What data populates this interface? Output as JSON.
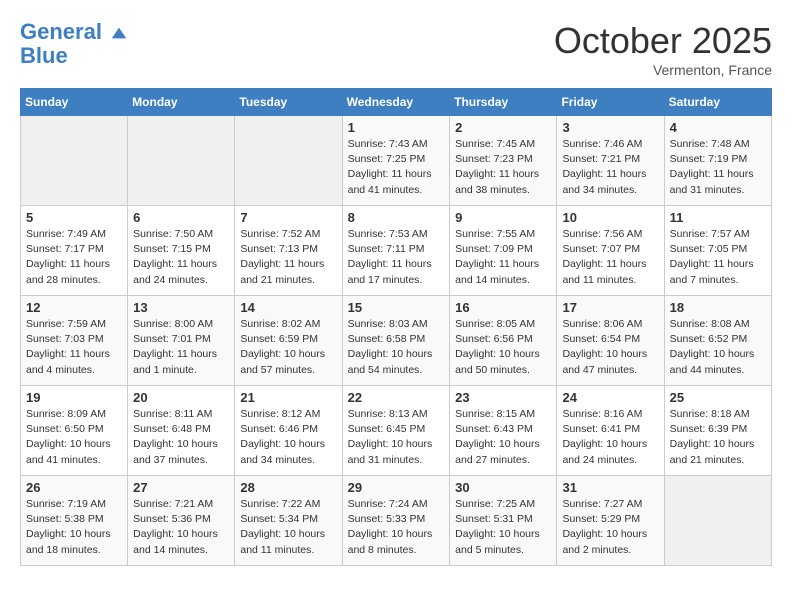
{
  "header": {
    "logo_line1": "General",
    "logo_line2": "Blue",
    "month": "October 2025",
    "location": "Vermenton, France"
  },
  "weekdays": [
    "Sunday",
    "Monday",
    "Tuesday",
    "Wednesday",
    "Thursday",
    "Friday",
    "Saturday"
  ],
  "weeks": [
    [
      {
        "day": "",
        "info": ""
      },
      {
        "day": "",
        "info": ""
      },
      {
        "day": "",
        "info": ""
      },
      {
        "day": "1",
        "info": "Sunrise: 7:43 AM\nSunset: 7:25 PM\nDaylight: 11 hours and 41 minutes."
      },
      {
        "day": "2",
        "info": "Sunrise: 7:45 AM\nSunset: 7:23 PM\nDaylight: 11 hours and 38 minutes."
      },
      {
        "day": "3",
        "info": "Sunrise: 7:46 AM\nSunset: 7:21 PM\nDaylight: 11 hours and 34 minutes."
      },
      {
        "day": "4",
        "info": "Sunrise: 7:48 AM\nSunset: 7:19 PM\nDaylight: 11 hours and 31 minutes."
      }
    ],
    [
      {
        "day": "5",
        "info": "Sunrise: 7:49 AM\nSunset: 7:17 PM\nDaylight: 11 hours and 28 minutes."
      },
      {
        "day": "6",
        "info": "Sunrise: 7:50 AM\nSunset: 7:15 PM\nDaylight: 11 hours and 24 minutes."
      },
      {
        "day": "7",
        "info": "Sunrise: 7:52 AM\nSunset: 7:13 PM\nDaylight: 11 hours and 21 minutes."
      },
      {
        "day": "8",
        "info": "Sunrise: 7:53 AM\nSunset: 7:11 PM\nDaylight: 11 hours and 17 minutes."
      },
      {
        "day": "9",
        "info": "Sunrise: 7:55 AM\nSunset: 7:09 PM\nDaylight: 11 hours and 14 minutes."
      },
      {
        "day": "10",
        "info": "Sunrise: 7:56 AM\nSunset: 7:07 PM\nDaylight: 11 hours and 11 minutes."
      },
      {
        "day": "11",
        "info": "Sunrise: 7:57 AM\nSunset: 7:05 PM\nDaylight: 11 hours and 7 minutes."
      }
    ],
    [
      {
        "day": "12",
        "info": "Sunrise: 7:59 AM\nSunset: 7:03 PM\nDaylight: 11 hours and 4 minutes."
      },
      {
        "day": "13",
        "info": "Sunrise: 8:00 AM\nSunset: 7:01 PM\nDaylight: 11 hours and 1 minute."
      },
      {
        "day": "14",
        "info": "Sunrise: 8:02 AM\nSunset: 6:59 PM\nDaylight: 10 hours and 57 minutes."
      },
      {
        "day": "15",
        "info": "Sunrise: 8:03 AM\nSunset: 6:58 PM\nDaylight: 10 hours and 54 minutes."
      },
      {
        "day": "16",
        "info": "Sunrise: 8:05 AM\nSunset: 6:56 PM\nDaylight: 10 hours and 50 minutes."
      },
      {
        "day": "17",
        "info": "Sunrise: 8:06 AM\nSunset: 6:54 PM\nDaylight: 10 hours and 47 minutes."
      },
      {
        "day": "18",
        "info": "Sunrise: 8:08 AM\nSunset: 6:52 PM\nDaylight: 10 hours and 44 minutes."
      }
    ],
    [
      {
        "day": "19",
        "info": "Sunrise: 8:09 AM\nSunset: 6:50 PM\nDaylight: 10 hours and 41 minutes."
      },
      {
        "day": "20",
        "info": "Sunrise: 8:11 AM\nSunset: 6:48 PM\nDaylight: 10 hours and 37 minutes."
      },
      {
        "day": "21",
        "info": "Sunrise: 8:12 AM\nSunset: 6:46 PM\nDaylight: 10 hours and 34 minutes."
      },
      {
        "day": "22",
        "info": "Sunrise: 8:13 AM\nSunset: 6:45 PM\nDaylight: 10 hours and 31 minutes."
      },
      {
        "day": "23",
        "info": "Sunrise: 8:15 AM\nSunset: 6:43 PM\nDaylight: 10 hours and 27 minutes."
      },
      {
        "day": "24",
        "info": "Sunrise: 8:16 AM\nSunset: 6:41 PM\nDaylight: 10 hours and 24 minutes."
      },
      {
        "day": "25",
        "info": "Sunrise: 8:18 AM\nSunset: 6:39 PM\nDaylight: 10 hours and 21 minutes."
      }
    ],
    [
      {
        "day": "26",
        "info": "Sunrise: 7:19 AM\nSunset: 5:38 PM\nDaylight: 10 hours and 18 minutes."
      },
      {
        "day": "27",
        "info": "Sunrise: 7:21 AM\nSunset: 5:36 PM\nDaylight: 10 hours and 14 minutes."
      },
      {
        "day": "28",
        "info": "Sunrise: 7:22 AM\nSunset: 5:34 PM\nDaylight: 10 hours and 11 minutes."
      },
      {
        "day": "29",
        "info": "Sunrise: 7:24 AM\nSunset: 5:33 PM\nDaylight: 10 hours and 8 minutes."
      },
      {
        "day": "30",
        "info": "Sunrise: 7:25 AM\nSunset: 5:31 PM\nDaylight: 10 hours and 5 minutes."
      },
      {
        "day": "31",
        "info": "Sunrise: 7:27 AM\nSunset: 5:29 PM\nDaylight: 10 hours and 2 minutes."
      },
      {
        "day": "",
        "info": ""
      }
    ]
  ]
}
